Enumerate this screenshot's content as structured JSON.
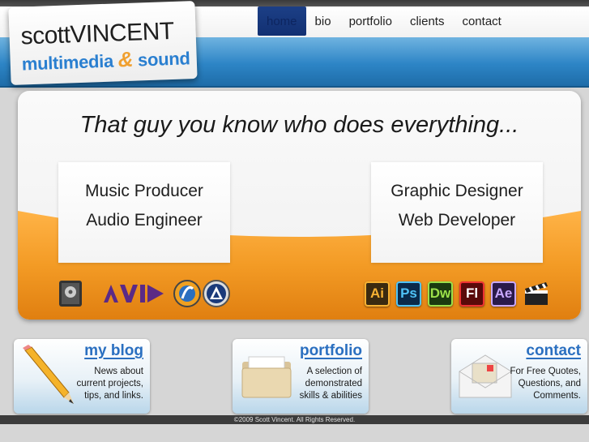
{
  "logo": {
    "name_first": "scott",
    "name_last": "VINCENT",
    "subtitle_a": "multimedia",
    "amp": "&",
    "subtitle_b": "sound"
  },
  "nav": {
    "items": [
      {
        "label": "home",
        "active": true
      },
      {
        "label": "bio",
        "active": false
      },
      {
        "label": "portfolio",
        "active": false
      },
      {
        "label": "clients",
        "active": false
      },
      {
        "label": "contact",
        "active": false
      }
    ]
  },
  "hero": {
    "tagline": "That guy you know who does everything...",
    "left_skills": [
      "Music Producer",
      "Audio Engineer"
    ],
    "right_skills": [
      "Graphic Designer",
      "Web Developer"
    ],
    "audio_icons": [
      "logic-icon",
      "avid-logo",
      "soundtrack-icon",
      "protools-icon"
    ],
    "avid_label": "AVID",
    "adobe_icons": [
      {
        "label": "Ai",
        "bg": "#3a2a10",
        "fg": "#f7b233"
      },
      {
        "label": "Ps",
        "bg": "#0a2a4a",
        "fg": "#4fc3f7"
      },
      {
        "label": "Dw",
        "bg": "#1b3a10",
        "fg": "#9be04a"
      },
      {
        "label": "Fl",
        "bg": "#5a0a0a",
        "fg": "#ffffff"
      },
      {
        "label": "Ae",
        "bg": "#2a1a4a",
        "fg": "#c8a8ff"
      }
    ]
  },
  "cards": [
    {
      "title": "my blog",
      "lines": [
        "News about",
        "current projects,",
        "tips, and links."
      ]
    },
    {
      "title": "portfolio",
      "lines": [
        "A selection of",
        "demonstrated",
        "skills & abilities"
      ]
    },
    {
      "title": "contact",
      "lines": [
        "For Free Quotes,",
        "Questions, and",
        "Comments."
      ]
    }
  ],
  "footer": {
    "copyright": "©2009 Scott Vincent. All Rights Reserved."
  },
  "colors": {
    "accent_blue": "#2a7fd0",
    "orange": "#f39b25",
    "nav_active": "#1c3f86"
  }
}
